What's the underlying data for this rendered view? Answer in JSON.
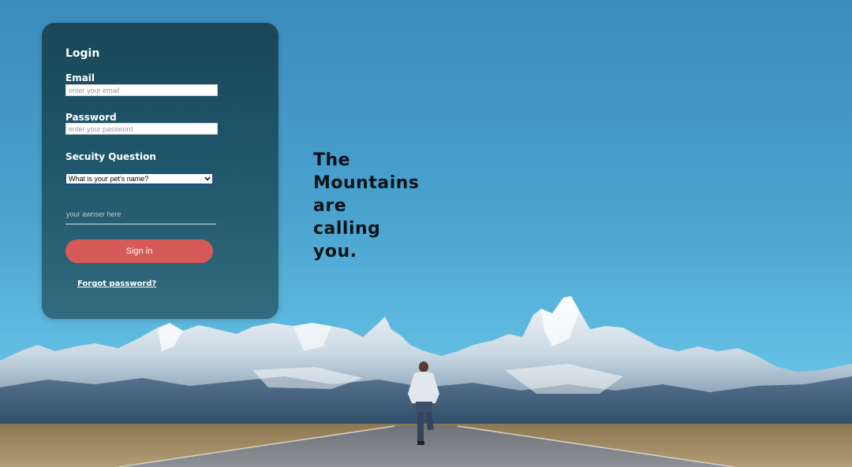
{
  "login": {
    "title": "Login",
    "email_label": "Email",
    "email_placeholder": "enter your email",
    "password_label": "Password",
    "password_placeholder": "enter your password",
    "security_label": "Secuity Question",
    "security_selected": "What is your pet's name?",
    "answer_placeholder": "your awnser here",
    "signin_label": "Sign in",
    "forgot_label": "Forgot password?"
  },
  "tagline": {
    "lines": [
      "The",
      "Mountains",
      "are",
      "calling",
      "you."
    ]
  },
  "colors": {
    "panel": "#1b4e5f",
    "signin_button": "#d65b58",
    "sky": "#4aa3cf"
  }
}
